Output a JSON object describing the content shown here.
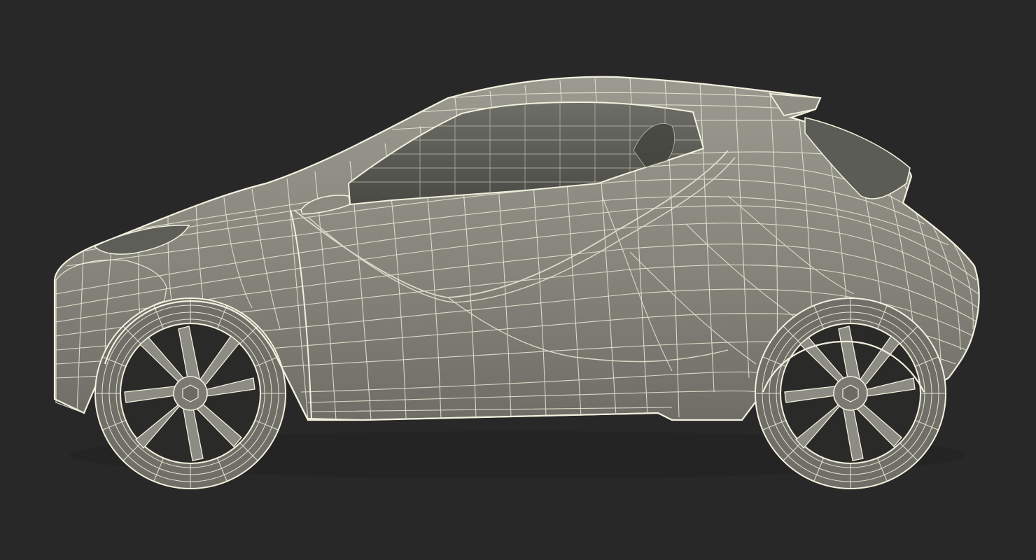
{
  "viewport": {
    "background_color": "#282828",
    "subject": "car-wireframe-side-view"
  },
  "colors": {
    "body_fill": "#8a8a80",
    "body_fill_dark": "#6f6f67",
    "glass_fill": "#55554f",
    "wire": "#f2f0de",
    "wire_dim": "#d8d6c4",
    "tire_dark": "#1a1a1a",
    "rim_fill": "#8c8c84"
  }
}
